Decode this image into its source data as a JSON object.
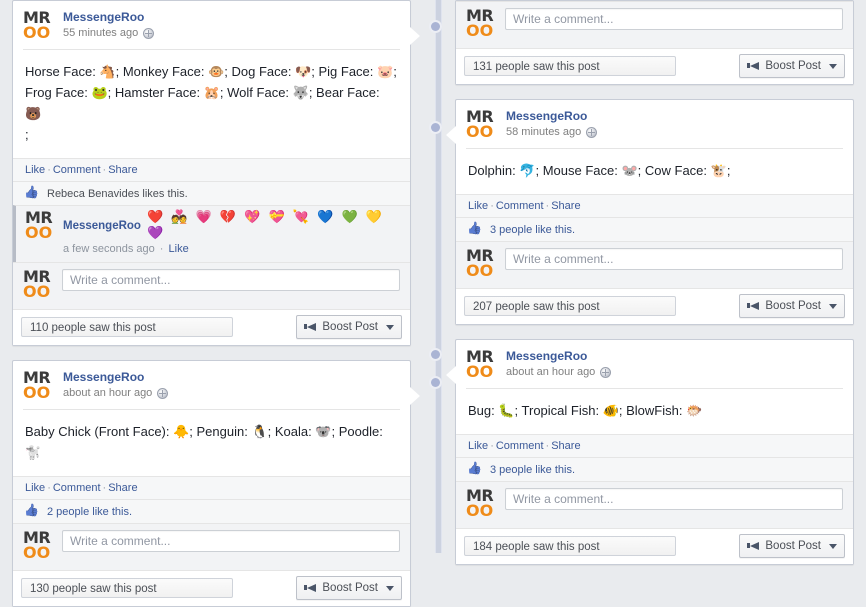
{
  "page": {
    "background_color": "#e9ebee",
    "card_background": "#ffffff",
    "link_color": "#3b5998",
    "accent_orange": "#ef8b19",
    "spine_color": "#ccd2e0"
  },
  "profile": {
    "avatar_top": "MR",
    "avatar_bottom": "OO",
    "name": "MessengeRoo"
  },
  "labels": {
    "like": "Like",
    "comment": "Comment",
    "share": "Share",
    "separator": "·",
    "boost": "Boost Post",
    "comment_placeholder": "Write a comment...",
    "globe_icon": "globe-icon",
    "thumb_icon": "thumbs-up-icon",
    "megaphone_icon": "megaphone-icon",
    "caret_icon": "chevron-down-icon"
  },
  "left_column": {
    "posts": [
      {
        "author": "MessengeRoo",
        "timestamp": "55 minutes ago",
        "privacy_icon": "globe-icon",
        "body_line1": "Horse Face: 🐴; Monkey Face: 🐵; Dog Face: 🐶; Pig Face: 🐷;",
        "body_line2": "Frog Face: 🐸; Hamster Face: 🐹; Wolf Face: 🐺; Bear Face: 🐻",
        "body_line3": ";",
        "likes_text": "Rebeca Benavides likes this.",
        "likes_count_text": "",
        "has_comment": true,
        "comment": {
          "author": "MessengeRoo",
          "hearts": "❤️ 💑 💗 💔 💖 💝 💘 💙 💚 💛 💜",
          "timestamp": "a few seconds ago",
          "separator": "·",
          "like_label": "Like"
        },
        "saw_text": "110 people saw this post",
        "boost_label": "Boost Post",
        "clipped_top": false
      },
      {
        "author": "MessengeRoo",
        "timestamp": "about an hour ago",
        "privacy_icon": "globe-icon",
        "body_line1": "Baby Chick (Front Face): 🐥; Penguin: 🐧; Koala: 🐨; Poodle: 🐩",
        "body_line2": "",
        "body_line3": "",
        "likes_text": "2 people like this.",
        "likes_count_text": "2 people",
        "has_comment": false,
        "saw_text": "130 people saw this post",
        "boost_label": "Boost Post",
        "clipped_top": false
      }
    ]
  },
  "right_column": {
    "posts": [
      {
        "author": "MessengeRoo",
        "timestamp": "",
        "privacy_icon": "globe-icon",
        "body_line1": "",
        "body_line2": "",
        "body_line3": "",
        "likes_text": "",
        "has_comment": false,
        "saw_text": "131 people saw this post",
        "boost_label": "Boost Post",
        "clipped_top": true
      },
      {
        "author": "MessengeRoo",
        "timestamp": "58 minutes ago",
        "privacy_icon": "globe-icon",
        "body_line1": "Dolphin: 🐬; Mouse Face: 🐭; Cow Face: 🐮;",
        "body_line2": "",
        "body_line3": "",
        "likes_text": "3 people like this.",
        "likes_count_text": "3 people",
        "has_comment": false,
        "saw_text": "207 people saw this post",
        "boost_label": "Boost Post",
        "clipped_top": false
      },
      {
        "author": "MessengeRoo",
        "timestamp": "about an hour ago",
        "privacy_icon": "globe-icon",
        "body_line1": "Bug: 🐛; Tropical Fish: 🐠; BlowFish: 🐡",
        "body_line2": "",
        "body_line3": "",
        "likes_text": "3 people like this.",
        "likes_count_text": "3 people",
        "has_comment": false,
        "saw_text": "184 people saw this post",
        "boost_label": "Boost Post",
        "clipped_top": false
      }
    ]
  }
}
